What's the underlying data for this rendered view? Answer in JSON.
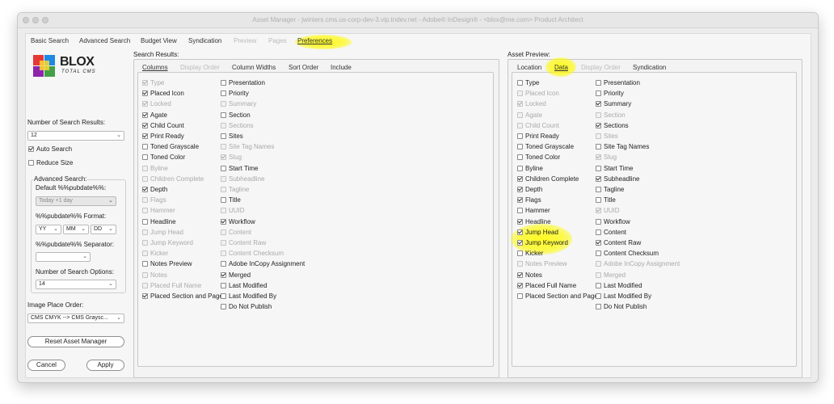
{
  "window": {
    "title": "Asset Manager - jwinters.cms.us-corp-dev-3.vip.tndev.net - Adobe® InDesign® - <blox@me.com> Product Architect"
  },
  "tabs": [
    {
      "label": "Basic Search",
      "state": "normal"
    },
    {
      "label": "Advanced Search",
      "state": "normal"
    },
    {
      "label": "Budget View",
      "state": "normal"
    },
    {
      "label": "Syndication",
      "state": "normal"
    },
    {
      "label": "Preview",
      "state": "disabled"
    },
    {
      "label": "Pages",
      "state": "disabled"
    },
    {
      "label": "Preferences",
      "state": "active"
    }
  ],
  "logo": {
    "word": "BLOX",
    "sub": "TOTAL CMS",
    "colors": [
      "#e53935",
      "#43a047",
      "#1e88e5",
      "#fdd835",
      "#8e24aa"
    ]
  },
  "left": {
    "num_results_label": "Number of Search Results:",
    "num_results_value": "12",
    "auto_search": "Auto Search",
    "reduce_size": "Reduce Size",
    "advanced_search_label": "Advanced Search:",
    "default_pubdate_label": "Default %%pubdate%%:",
    "default_pubdate_value": "Today +1 day",
    "pubdate_format_label": "%%pubdate%% Format:",
    "format_yy": "YY",
    "format_mm": "MM",
    "format_dd": "DD",
    "separator_label": "%%pubdate%% Separator:",
    "separator_value": "",
    "num_options_label": "Number of Search Options:",
    "num_options_value": "14",
    "image_place_label": "Image Place Order:",
    "image_place_value": "CMS CMYK --> CMS Graysc...",
    "reset_button": "Reset Asset Manager",
    "cancel_button": "Cancel",
    "apply_button": "Apply"
  },
  "search_results": {
    "title": "Search Results:",
    "subtabs": [
      {
        "label": "Columns",
        "state": "active"
      },
      {
        "label": "Display Order",
        "state": "disabled"
      },
      {
        "label": "Column Widths",
        "state": "normal"
      },
      {
        "label": "Sort Order",
        "state": "normal"
      },
      {
        "label": "Include",
        "state": "normal"
      }
    ],
    "col1": [
      {
        "label": "Type",
        "checked": true,
        "disabled": true
      },
      {
        "label": "Placed Icon",
        "checked": true,
        "disabled": false
      },
      {
        "label": "Locked",
        "checked": true,
        "disabled": true
      },
      {
        "label": "Agate",
        "checked": true,
        "disabled": false
      },
      {
        "label": "Child Count",
        "checked": true,
        "disabled": false
      },
      {
        "label": "Print Ready",
        "checked": true,
        "disabled": false
      },
      {
        "label": "Toned Grayscale",
        "checked": false,
        "disabled": false
      },
      {
        "label": "Toned Color",
        "checked": false,
        "disabled": false
      },
      {
        "label": "Byline",
        "checked": false,
        "disabled": true
      },
      {
        "label": "Children Complete",
        "checked": false,
        "disabled": true
      },
      {
        "label": "Depth",
        "checked": true,
        "disabled": false
      },
      {
        "label": "Flags",
        "checked": false,
        "disabled": true
      },
      {
        "label": "Hammer",
        "checked": false,
        "disabled": true
      },
      {
        "label": "Headline",
        "checked": false,
        "disabled": false
      },
      {
        "label": "Jump Head",
        "checked": false,
        "disabled": true
      },
      {
        "label": "Jump Keyword",
        "checked": false,
        "disabled": true
      },
      {
        "label": "Kicker",
        "checked": false,
        "disabled": true
      },
      {
        "label": "Notes Preview",
        "checked": false,
        "disabled": false
      },
      {
        "label": "Notes",
        "checked": false,
        "disabled": true
      },
      {
        "label": "Placed Full Name",
        "checked": false,
        "disabled": true
      },
      {
        "label": "Placed Section and Page",
        "checked": true,
        "disabled": false
      }
    ],
    "col2": [
      {
        "label": "Presentation",
        "checked": false,
        "disabled": false
      },
      {
        "label": "Priority",
        "checked": false,
        "disabled": false
      },
      {
        "label": "Summary",
        "checked": false,
        "disabled": true
      },
      {
        "label": "Section",
        "checked": false,
        "disabled": false
      },
      {
        "label": "Sections",
        "checked": false,
        "disabled": true
      },
      {
        "label": "Sites",
        "checked": false,
        "disabled": false
      },
      {
        "label": "Site Tag Names",
        "checked": false,
        "disabled": true
      },
      {
        "label": "Slug",
        "checked": true,
        "disabled": true
      },
      {
        "label": "Start Time",
        "checked": false,
        "disabled": false
      },
      {
        "label": "Subheadline",
        "checked": false,
        "disabled": true
      },
      {
        "label": "Tagline",
        "checked": false,
        "disabled": true
      },
      {
        "label": "Title",
        "checked": false,
        "disabled": false
      },
      {
        "label": "UUID",
        "checked": false,
        "disabled": true
      },
      {
        "label": "Workflow",
        "checked": true,
        "disabled": false
      },
      {
        "label": "Content",
        "checked": false,
        "disabled": true
      },
      {
        "label": "Content Raw",
        "checked": false,
        "disabled": true
      },
      {
        "label": "Content Checksum",
        "checked": false,
        "disabled": true
      },
      {
        "label": "Adobe InCopy Assignment",
        "checked": false,
        "disabled": false
      },
      {
        "label": "Merged",
        "checked": true,
        "disabled": false
      },
      {
        "label": "Last Modified",
        "checked": false,
        "disabled": false
      },
      {
        "label": "Last Modified By",
        "checked": false,
        "disabled": false
      },
      {
        "label": "Do Not Publish",
        "checked": false,
        "disabled": false
      }
    ]
  },
  "asset_preview": {
    "title": "Asset Preview:",
    "subtabs": [
      {
        "label": "Location",
        "state": "normal"
      },
      {
        "label": "Data",
        "state": "active"
      },
      {
        "label": "Display Order",
        "state": "disabled"
      },
      {
        "label": "Syndication",
        "state": "normal"
      }
    ],
    "col1": [
      {
        "label": "Type",
        "checked": false,
        "disabled": false
      },
      {
        "label": "Placed Icon",
        "checked": false,
        "disabled": true
      },
      {
        "label": "Locked",
        "checked": true,
        "disabled": true
      },
      {
        "label": "Agate",
        "checked": false,
        "disabled": true
      },
      {
        "label": "Child Count",
        "checked": false,
        "disabled": true
      },
      {
        "label": "Print Ready",
        "checked": false,
        "disabled": false
      },
      {
        "label": "Toned Grayscale",
        "checked": false,
        "disabled": false
      },
      {
        "label": "Toned Color",
        "checked": false,
        "disabled": false
      },
      {
        "label": "Byline",
        "checked": false,
        "disabled": false
      },
      {
        "label": "Children Complete",
        "checked": true,
        "disabled": false
      },
      {
        "label": "Depth",
        "checked": true,
        "disabled": false
      },
      {
        "label": "Flags",
        "checked": true,
        "disabled": false
      },
      {
        "label": "Hammer",
        "checked": false,
        "disabled": false
      },
      {
        "label": "Headline",
        "checked": true,
        "disabled": false
      },
      {
        "label": "Jump Head",
        "checked": true,
        "disabled": false,
        "highlight": true
      },
      {
        "label": "Jump Keyword",
        "checked": true,
        "disabled": false,
        "highlight": true
      },
      {
        "label": "Kicker",
        "checked": false,
        "disabled": false
      },
      {
        "label": "Notes Preview",
        "checked": false,
        "disabled": true
      },
      {
        "label": "Notes",
        "checked": true,
        "disabled": false
      },
      {
        "label": "Placed Full Name",
        "checked": true,
        "disabled": false
      },
      {
        "label": "Placed Section and Page",
        "checked": false,
        "disabled": false
      }
    ],
    "col2": [
      {
        "label": "Presentation",
        "checked": false,
        "disabled": false
      },
      {
        "label": "Priority",
        "checked": false,
        "disabled": false
      },
      {
        "label": "Summary",
        "checked": true,
        "disabled": false
      },
      {
        "label": "Section",
        "checked": false,
        "disabled": true
      },
      {
        "label": "Sections",
        "checked": true,
        "disabled": false
      },
      {
        "label": "Sites",
        "checked": false,
        "disabled": true
      },
      {
        "label": "Site Tag Names",
        "checked": false,
        "disabled": false
      },
      {
        "label": "Slug",
        "checked": true,
        "disabled": true
      },
      {
        "label": "Start Time",
        "checked": false,
        "disabled": false
      },
      {
        "label": "Subheadline",
        "checked": true,
        "disabled": false
      },
      {
        "label": "Tagline",
        "checked": false,
        "disabled": false
      },
      {
        "label": "Title",
        "checked": false,
        "disabled": false
      },
      {
        "label": "UUID",
        "checked": true,
        "disabled": true
      },
      {
        "label": "Workflow",
        "checked": false,
        "disabled": false
      },
      {
        "label": "Content",
        "checked": false,
        "disabled": false
      },
      {
        "label": "Content Raw",
        "checked": true,
        "disabled": false
      },
      {
        "label": "Content Checksum",
        "checked": false,
        "disabled": false
      },
      {
        "label": "Adobe InCopy Assignment",
        "checked": false,
        "disabled": true
      },
      {
        "label": "Merged",
        "checked": false,
        "disabled": true
      },
      {
        "label": "Last Modified",
        "checked": false,
        "disabled": false
      },
      {
        "label": "Last Modified By",
        "checked": false,
        "disabled": false
      },
      {
        "label": "Do Not Publish",
        "checked": false,
        "disabled": false
      }
    ]
  }
}
